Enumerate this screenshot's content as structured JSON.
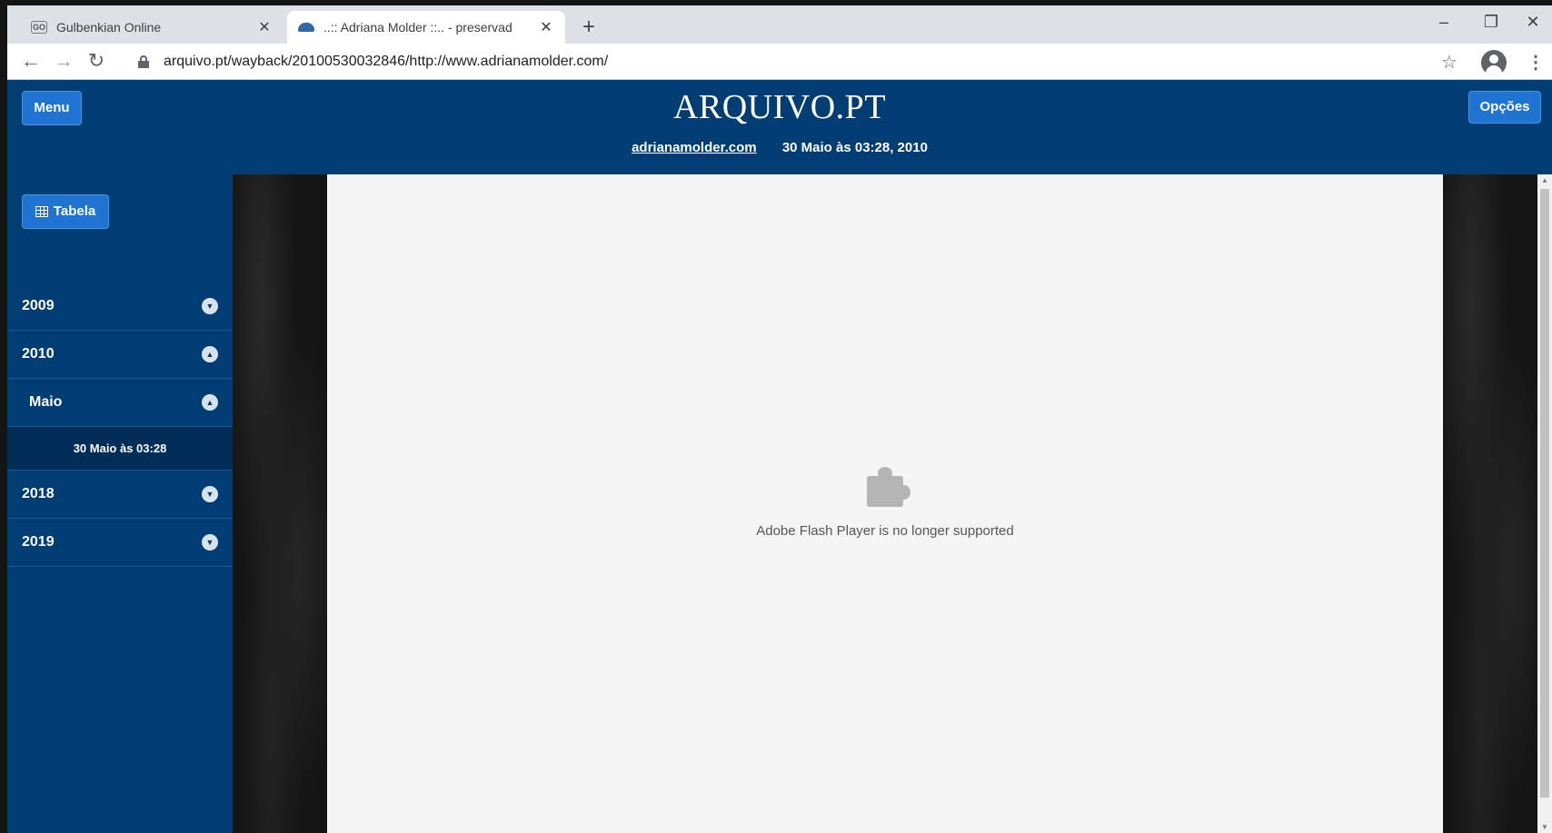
{
  "browser": {
    "tabs": [
      {
        "title": "Gulbenkian Online",
        "favicon": "GO",
        "active": false
      },
      {
        "title": "..:: Adriana Molder ::.. - preservad",
        "favicon": "arquivo-icon",
        "active": true
      }
    ],
    "new_tab": "+",
    "window_controls": {
      "minimize": "–",
      "restore": "❐",
      "close": "✕"
    },
    "toolbar": {
      "back": "←",
      "forward": "→",
      "reload": "↻",
      "url": "arquivo.pt/wayback/20100530032846/http://www.adrianamolder.com/",
      "bookmark": "☆",
      "menu": "⋮"
    }
  },
  "header": {
    "menu_label": "Menu",
    "logo": "ARQUIVO.PT",
    "options_label": "Opções",
    "site": "adrianamolder.com",
    "capture_date": "30 Maio às 03:28, 2010"
  },
  "sidebar": {
    "tabela_label": "Tabela",
    "years": [
      {
        "label": "2009",
        "expanded": false
      },
      {
        "label": "2010",
        "expanded": true
      },
      {
        "label": "Maio",
        "expanded": true
      },
      {
        "label": "30 Maio às 03:28"
      },
      {
        "label": "2018",
        "expanded": false
      },
      {
        "label": "2019",
        "expanded": false
      }
    ]
  },
  "content": {
    "plugin_message": "Adobe Flash Player is no longer supported"
  },
  "colors": {
    "header_bg": "#003d73",
    "button_bg": "#1f74d1",
    "frame_bg": "#f5f5f5"
  }
}
